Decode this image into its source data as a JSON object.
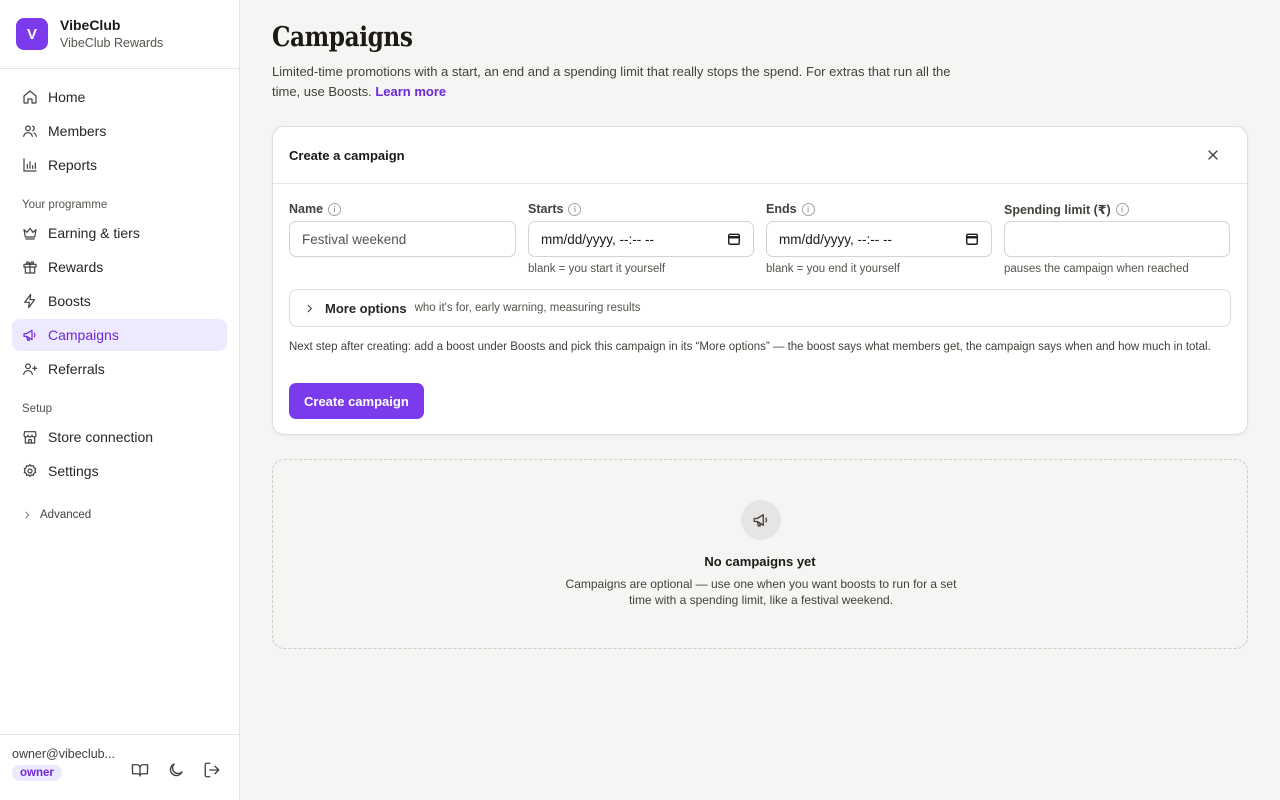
{
  "brand": {
    "logo_letter": "V",
    "name": "VibeClub",
    "subtitle": "VibeClub Rewards",
    "accent": "#7c3aed"
  },
  "nav": {
    "main": [
      {
        "label": "Home",
        "icon": "home-icon"
      },
      {
        "label": "Members",
        "icon": "users-icon"
      },
      {
        "label": "Reports",
        "icon": "bar-chart-icon"
      }
    ],
    "programme_label": "Your programme",
    "programme": [
      {
        "label": "Earning & tiers",
        "icon": "crown-icon"
      },
      {
        "label": "Rewards",
        "icon": "gift-icon"
      },
      {
        "label": "Boosts",
        "icon": "zap-icon"
      },
      {
        "label": "Campaigns",
        "icon": "megaphone-icon",
        "active": true
      },
      {
        "label": "Referrals",
        "icon": "user-plus-icon"
      }
    ],
    "setup_label": "Setup",
    "setup": [
      {
        "label": "Store connection",
        "icon": "store-icon"
      },
      {
        "label": "Settings",
        "icon": "gear-icon"
      }
    ],
    "advanced_label": "Advanced"
  },
  "user": {
    "email": "owner@vibeclub...",
    "role": "owner"
  },
  "page": {
    "title": "Campaigns",
    "description": "Limited-time promotions with a start, an end and a spending limit that really stops the spend. For extras that run all the time, use Boosts.",
    "learn_more": "Learn more"
  },
  "create_card": {
    "title": "Create a campaign",
    "fields": {
      "name": {
        "label": "Name",
        "value": "Festival weekend"
      },
      "starts": {
        "label": "Starts",
        "value": "mm/dd/yyyy, --:-- --",
        "hint": "blank = you start it yourself"
      },
      "ends": {
        "label": "Ends",
        "value": "mm/dd/yyyy, --:-- --",
        "hint": "blank = you end it yourself"
      },
      "limit": {
        "label": "Spending limit (₹)",
        "value": "",
        "hint": "pauses the campaign when reached"
      }
    },
    "more_options": {
      "label": "More options",
      "sub": "who it's for, early warning, measuring results"
    },
    "next_step": "Next step after creating: add a boost under Boosts and pick this campaign in its “More options” — the boost says what members get, the campaign says when and how much in total.",
    "submit": "Create campaign"
  },
  "empty_state": {
    "title": "No campaigns yet",
    "description": "Campaigns are optional — use one when you want boosts to run for a set time with a spending limit, like a festival weekend."
  }
}
